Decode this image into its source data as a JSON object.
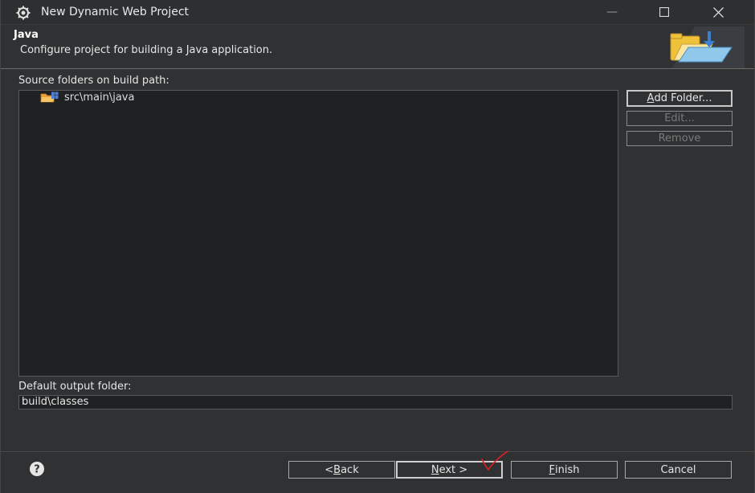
{
  "window": {
    "title": "New Dynamic Web Project",
    "minimize_glyph": "—",
    "maximize_glyph": "☐",
    "close_glyph": "✕"
  },
  "header": {
    "title": "Java",
    "description": "Configure project for building a Java application."
  },
  "source": {
    "label": "Source folders on build path:",
    "items": [
      {
        "label": "src\\main\\java",
        "icon": "package-folder-icon"
      }
    ]
  },
  "side_buttons": {
    "add_folder": {
      "pre": "",
      "mn": "A",
      "post": "dd Folder..."
    },
    "edit": "Edit...",
    "remove": "Remove"
  },
  "output": {
    "label": "Default output folder:",
    "value": "build\\classes"
  },
  "footer": {
    "back": {
      "pre": "< ",
      "mn": "B",
      "post": "ack"
    },
    "next": {
      "pre": "",
      "mn": "N",
      "post": "ext >"
    },
    "finish": {
      "pre": "",
      "mn": "F",
      "post": "inish"
    },
    "cancel": "Cancel"
  },
  "colors": {
    "background": "#2f3133",
    "tree_bg": "#1f2123",
    "check_mark": "#e02020"
  }
}
